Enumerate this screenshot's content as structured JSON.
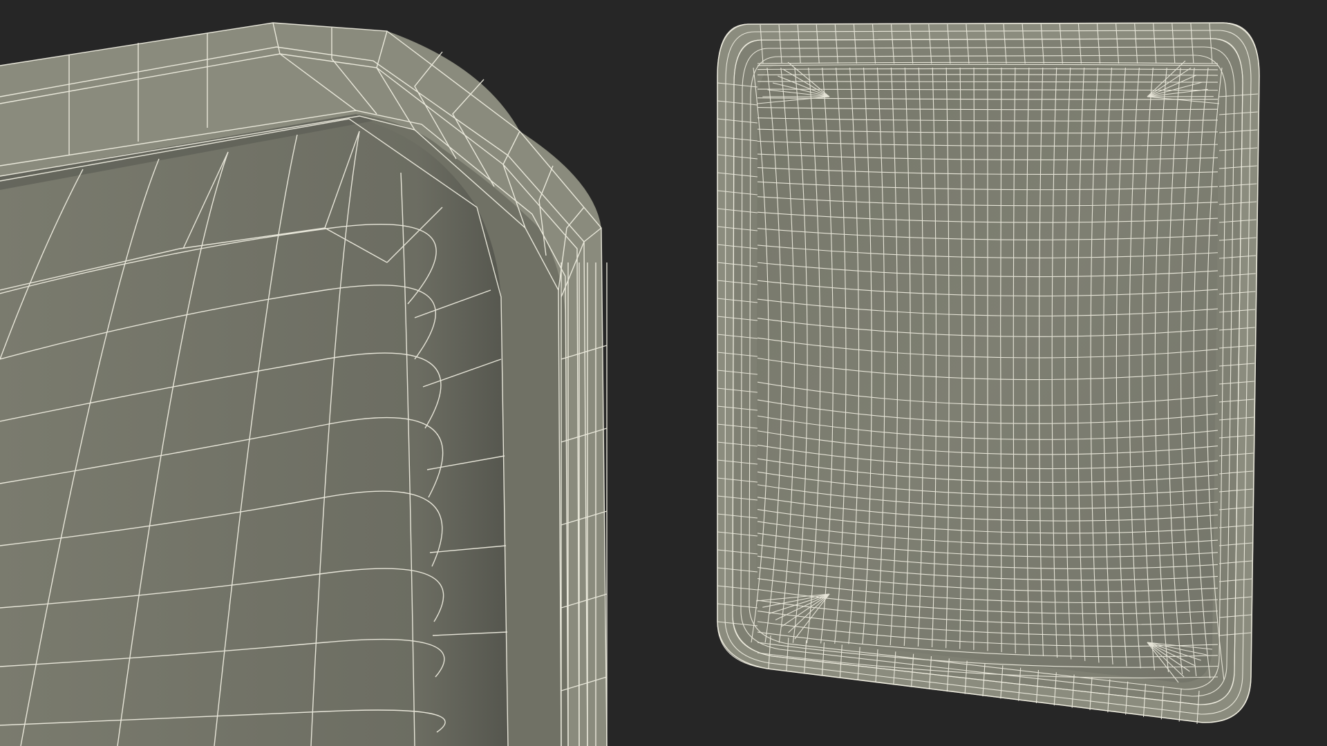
{
  "scene": {
    "background_color": "#262626",
    "surface_color": "#7b7c6f",
    "surface_shadow_color": "#5a5b52",
    "rim_color": "#8a8b7d",
    "wire_color": "#f3f1e4"
  },
  "views": [
    {
      "name": "closeup-corner-view"
    },
    {
      "name": "full-tray-top-view"
    }
  ]
}
